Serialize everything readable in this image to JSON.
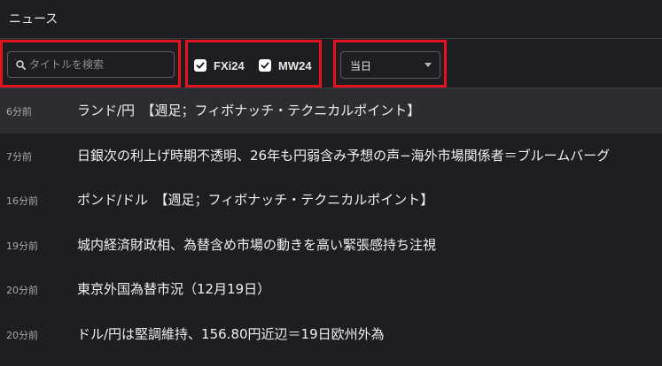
{
  "app": {
    "title": "ニュース"
  },
  "toolbar": {
    "search": {
      "placeholder": "タイトルを検索",
      "value": ""
    },
    "filters": [
      {
        "label": "FXi24",
        "checked": true
      },
      {
        "label": "MW24",
        "checked": true
      }
    ],
    "date_select": {
      "value": "当日"
    }
  },
  "news": [
    {
      "time": "6分前",
      "headline": "ランド/円　【週足；フィボナッチ・テクニカルポイント】"
    },
    {
      "time": "7分前",
      "headline": "日銀次の利上げ時期不透明、26年も円弱含み予想の声−海外市場関係者＝ブルームバーグ"
    },
    {
      "time": "16分前",
      "headline": "ポンド/ドル　【週足；フィボナッチ・テクニカルポイント】"
    },
    {
      "time": "19分前",
      "headline": "城内経済財政相、為替含め市場の動きを高い緊張感持ち注視"
    },
    {
      "time": "20分前",
      "headline": "東京外国為替市況（12月19日）"
    },
    {
      "time": "20分前",
      "headline": "ドル/円は堅調維持、156.80円近辺＝19日欧州外為"
    }
  ]
}
